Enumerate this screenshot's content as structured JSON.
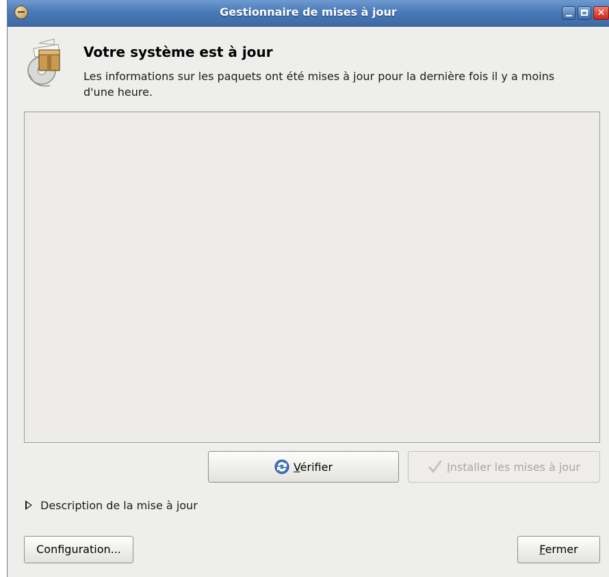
{
  "window": {
    "title": "Gestionnaire de mises à jour"
  },
  "header": {
    "icon": "package-update-icon",
    "heading": "Votre système est à jour",
    "message": "Les informations sur les paquets ont été mises à jour pour la dernière fois il y a moins d'une heure."
  },
  "buttons": {
    "verifier": {
      "accel": "V",
      "rest": "érifier",
      "icon": "refresh-icon"
    },
    "installer": {
      "accel": "I",
      "rest": "nstaller les mises à jour",
      "icon": "checkmark-icon",
      "enabled": false
    },
    "configuration": "Configuration...",
    "fermer": {
      "accel": "F",
      "rest": "ermer"
    }
  },
  "expander": {
    "label": "Description de la mise à jour",
    "expanded": false
  },
  "colors": {
    "titlebar": "#4a7ab8",
    "window_bg": "#eeeeec",
    "close_button": "#c9261a"
  }
}
